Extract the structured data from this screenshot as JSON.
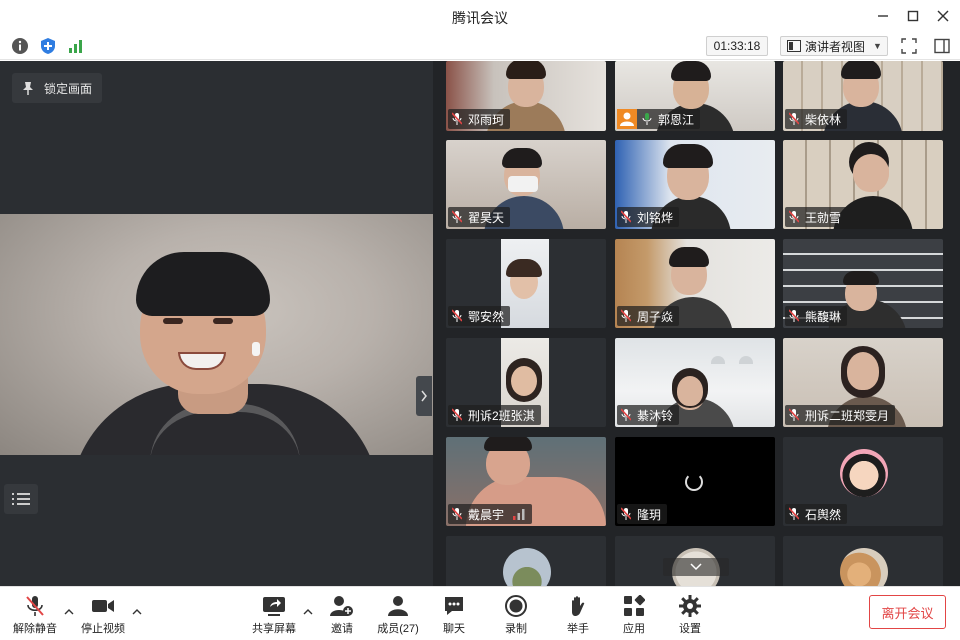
{
  "window": {
    "title": "腾讯会议"
  },
  "statusbar": {
    "timer": "01:33:18",
    "view_mode": "演讲者视图"
  },
  "stage": {
    "lock_label": "锁定画面"
  },
  "participants": [
    {
      "name": "邓雨珂",
      "muted": true
    },
    {
      "name": "郭恩江",
      "muted": false
    },
    {
      "name": "柴依林",
      "muted": true
    },
    {
      "name": "翟昊天",
      "muted": true
    },
    {
      "name": "刘铭烨",
      "muted": true
    },
    {
      "name": "王勍雪",
      "muted": true
    },
    {
      "name": "鄂安然",
      "muted": true
    },
    {
      "name": "周子焱",
      "muted": true
    },
    {
      "name": "熊馥琳",
      "muted": true
    },
    {
      "name": "刑诉2班张淇",
      "muted": true
    },
    {
      "name": "綦沐铃",
      "muted": true
    },
    {
      "name": "刑诉二班郑雯月",
      "muted": true
    },
    {
      "name": "戴晨宇",
      "muted": true
    },
    {
      "name": "隆玥",
      "muted": true
    },
    {
      "name": "石舆然",
      "muted": true
    }
  ],
  "toolbar": {
    "unmute": "解除静音",
    "stop_video": "停止视频",
    "share_screen": "共享屏幕",
    "invite": "邀请",
    "members": "成员(27)",
    "chat": "聊天",
    "record": "录制",
    "raise_hand": "举手",
    "apps": "应用",
    "settings": "设置",
    "leave": "离开会议"
  },
  "colors": {
    "accent_green": "#3aa54a",
    "leave_red": "#e24545",
    "stage_bg": "#2b2e32",
    "gallery_bg": "#222427"
  }
}
